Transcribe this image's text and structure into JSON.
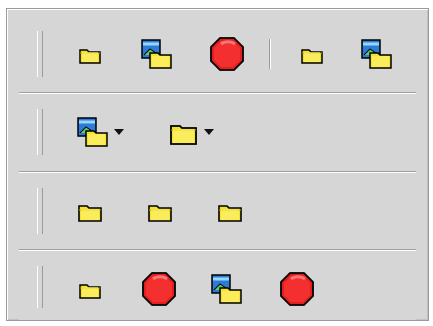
{
  "app": {
    "title": ""
  },
  "toolbars": [
    {
      "name": "toolbar-1",
      "items": [
        "folder",
        "picture-folder",
        "stop",
        "separator",
        "folder",
        "picture-folder"
      ]
    },
    {
      "name": "toolbar-2",
      "items": [
        "picture-folder-dropdown",
        "folder-dropdown"
      ]
    },
    {
      "name": "toolbar-3",
      "items": [
        "folder",
        "folder",
        "folder"
      ]
    },
    {
      "name": "toolbar-4",
      "items": [
        "folder",
        "stop",
        "picture-folder",
        "stop"
      ]
    }
  ],
  "icons": {
    "folder": "folder-icon",
    "picture_folder": "picture-folder-icon",
    "stop": "stop-icon",
    "dropdown": "chevron-down-icon"
  },
  "colors": {
    "panel_bg": "#d6d6d6",
    "folder_yellow": "#ffeb3b",
    "stop_red": "#e41e1e",
    "border_dark": "#9a9a9a"
  }
}
